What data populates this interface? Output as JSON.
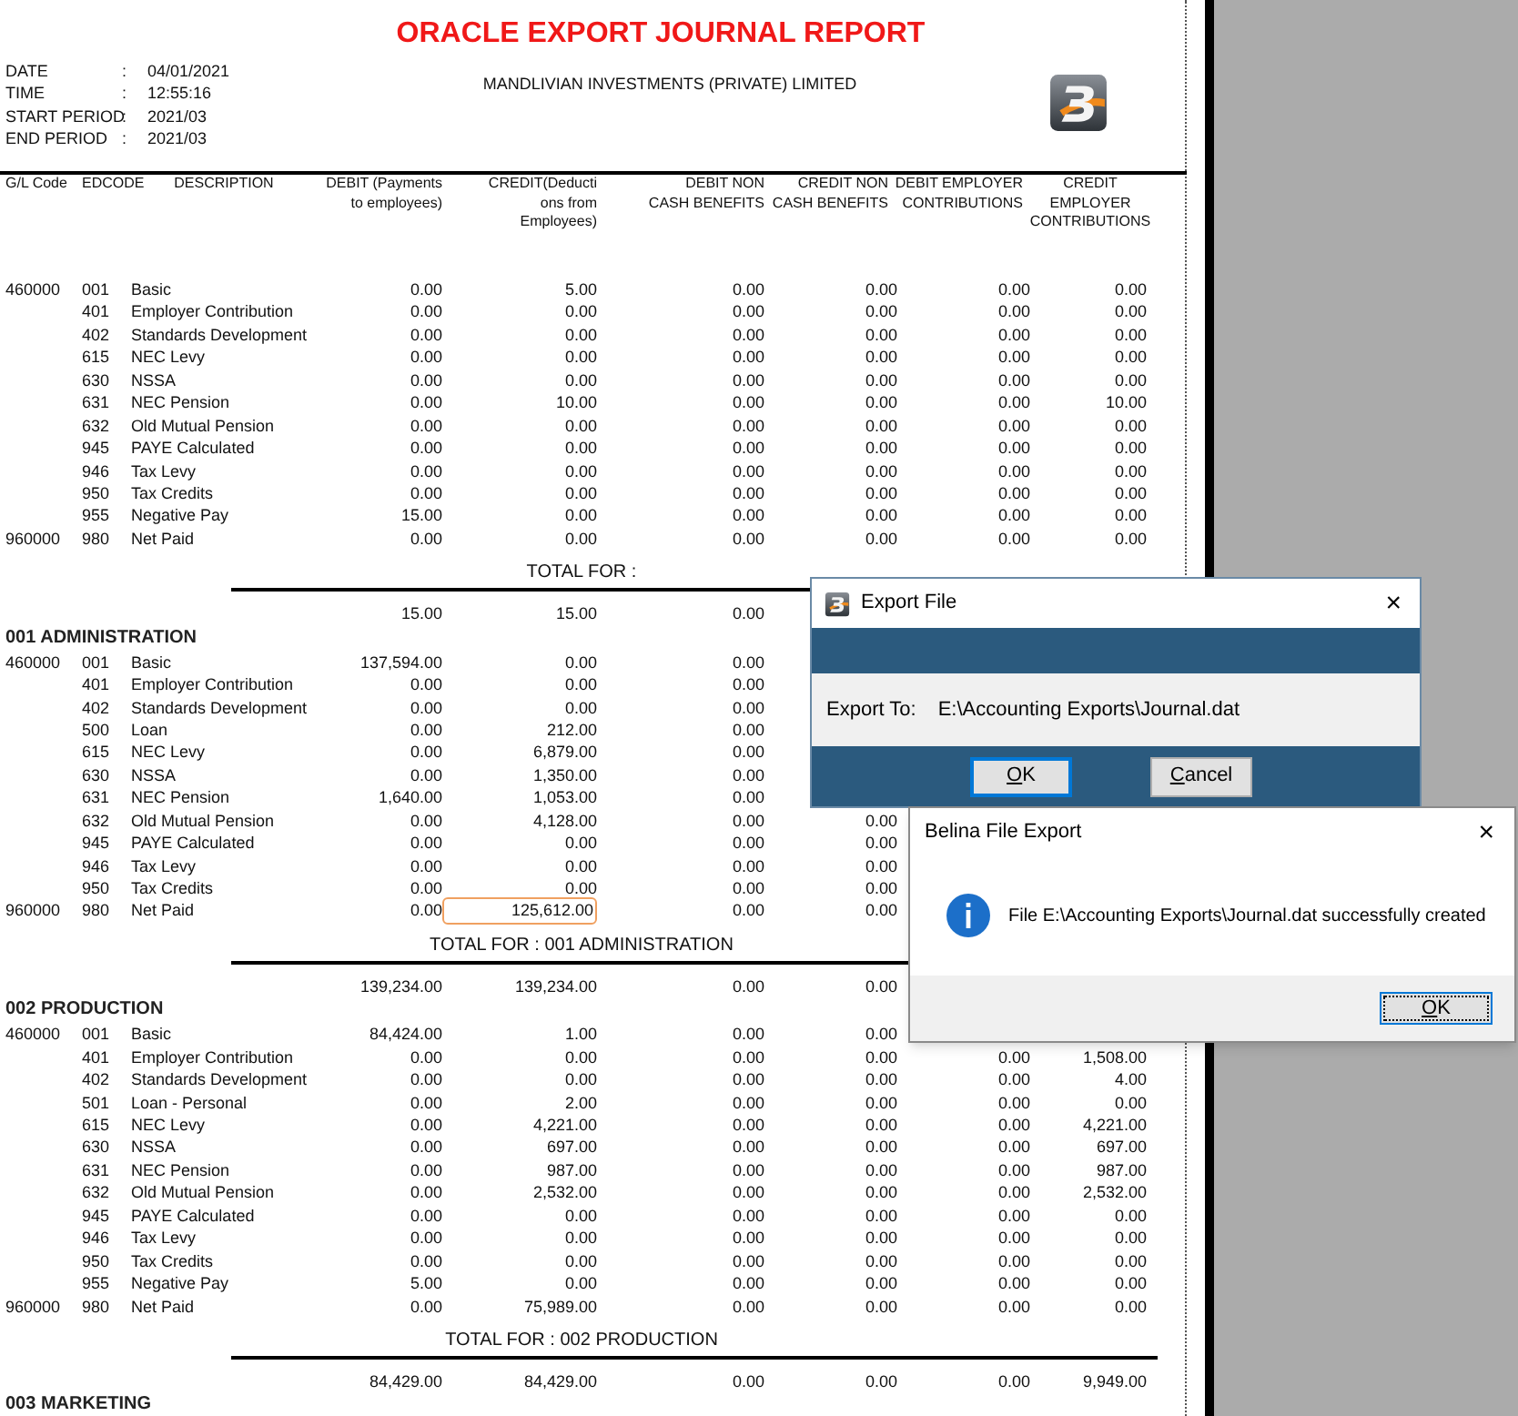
{
  "report": {
    "title": "ORACLE EXPORT JOURNAL REPORT",
    "company": "MANDLIVIAN INVESTMENTS (PRIVATE) LIMITED",
    "info": [
      {
        "label": "DATE",
        "colon": ":",
        "value": "04/01/2021"
      },
      {
        "label": "TIME",
        "colon": ":",
        "value": "12:55:16"
      },
      {
        "label": "START PERIOD",
        "colon": ":",
        "value": "2021/03"
      },
      {
        "label": "END PERIOD",
        "colon": ":",
        "value": "2021/03"
      }
    ],
    "columns": [
      {
        "lines": [
          "G/L Code"
        ]
      },
      {
        "lines": [
          "EDCODE"
        ]
      },
      {
        "lines": [
          "DESCRIPTION"
        ]
      },
      {
        "lines": [
          "DEBIT (Payments",
          "to employees)"
        ]
      },
      {
        "lines": [
          "CREDIT(Deducti",
          "ons from",
          "Employees)"
        ]
      },
      {
        "lines": [
          "DEBIT NON",
          "CASH BENEFITS"
        ]
      },
      {
        "lines": [
          "CREDIT NON",
          "CASH BENEFITS"
        ]
      },
      {
        "lines": [
          "DEBIT EMPLOYER",
          "CONTRIBUTIONS"
        ]
      },
      {
        "lines": [
          "CREDIT",
          "EMPLOYER",
          "CONTRIBUTIONS"
        ]
      }
    ],
    "sections": [
      {
        "rows": [
          {
            "gl_code": "460000",
            "ed_code": "001",
            "description": "Basic",
            "amounts": [
              "0.00",
              "5.00",
              "0.00",
              "0.00",
              "0.00",
              "0.00"
            ]
          },
          {
            "ed_code": "401",
            "description": "Employer Contribution",
            "amounts": [
              "0.00",
              "0.00",
              "0.00",
              "0.00",
              "0.00",
              "0.00"
            ]
          },
          {
            "ed_code": "402",
            "description": "Standards Development",
            "amounts": [
              "0.00",
              "0.00",
              "0.00",
              "0.00",
              "0.00",
              "0.00"
            ]
          },
          {
            "ed_code": "615",
            "description": "NEC Levy",
            "amounts": [
              "0.00",
              "0.00",
              "0.00",
              "0.00",
              "0.00",
              "0.00"
            ]
          },
          {
            "ed_code": "630",
            "description": "NSSA",
            "amounts": [
              "0.00",
              "0.00",
              "0.00",
              "0.00",
              "0.00",
              "0.00"
            ]
          },
          {
            "ed_code": "631",
            "description": "NEC Pension",
            "amounts": [
              "0.00",
              "10.00",
              "0.00",
              "0.00",
              "0.00",
              "10.00"
            ]
          },
          {
            "ed_code": "632",
            "description": "Old Mutual Pension",
            "amounts": [
              "0.00",
              "0.00",
              "0.00",
              "0.00",
              "0.00",
              "0.00"
            ]
          },
          {
            "ed_code": "945",
            "description": "PAYE Calculated",
            "amounts": [
              "0.00",
              "0.00",
              "0.00",
              "0.00",
              "0.00",
              "0.00"
            ]
          },
          {
            "ed_code": "946",
            "description": "Tax Levy",
            "amounts": [
              "0.00",
              "0.00",
              "0.00",
              "0.00",
              "0.00",
              "0.00"
            ]
          },
          {
            "ed_code": "950",
            "description": "Tax Credits",
            "amounts": [
              "0.00",
              "0.00",
              "0.00",
              "0.00",
              "0.00",
              "0.00"
            ]
          },
          {
            "ed_code": "955",
            "description": "Negative Pay",
            "amounts": [
              "15.00",
              "0.00",
              "0.00",
              "0.00",
              "0.00",
              "0.00"
            ]
          },
          {
            "gl_code": "960000",
            "ed_code": "980",
            "description": "Net Paid",
            "amounts": [
              "0.00",
              "0.00",
              "0.00",
              "0.00",
              "0.00",
              "0.00"
            ]
          }
        ],
        "total_label": "TOTAL FOR :",
        "totals": [
          "15.00",
          "15.00",
          "0.00"
        ]
      },
      {
        "title": "001 ADMINISTRATION",
        "rows": [
          {
            "gl_code": "460000",
            "ed_code": "001",
            "description": "Basic",
            "amounts": [
              "137,594.00",
              "0.00",
              "0.00"
            ]
          },
          {
            "ed_code": "401",
            "description": "Employer Contribution",
            "amounts": [
              "0.00",
              "0.00",
              "0.00"
            ]
          },
          {
            "ed_code": "402",
            "description": "Standards Development",
            "amounts": [
              "0.00",
              "0.00",
              "0.00"
            ]
          },
          {
            "ed_code": "500",
            "description": "Loan",
            "amounts": [
              "0.00",
              "212.00",
              "0.00"
            ]
          },
          {
            "ed_code": "615",
            "description": "NEC Levy",
            "amounts": [
              "0.00",
              "6,879.00",
              "0.00"
            ]
          },
          {
            "ed_code": "630",
            "description": "NSSA",
            "amounts": [
              "0.00",
              "1,350.00",
              "0.00"
            ]
          },
          {
            "ed_code": "631",
            "description": "NEC Pension",
            "amounts": [
              "1,640.00",
              "1,053.00",
              "0.00"
            ]
          },
          {
            "ed_code": "632",
            "description": "Old Mutual Pension",
            "amounts": [
              "0.00",
              "4,128.00",
              "0.00",
              "0.00"
            ]
          },
          {
            "ed_code": "945",
            "description": "PAYE Calculated",
            "amounts": [
              "0.00",
              "0.00",
              "0.00",
              "0.00"
            ]
          },
          {
            "ed_code": "946",
            "description": "Tax Levy",
            "amounts": [
              "0.00",
              "0.00",
              "0.00",
              "0.00"
            ]
          },
          {
            "ed_code": "950",
            "description": "Tax Credits",
            "amounts": [
              "0.00",
              "0.00",
              "0.00",
              "0.00"
            ]
          },
          {
            "gl_code": "960000",
            "ed_code": "980",
            "description": "Net Paid",
            "amounts": [
              "0.00",
              {
                "text": "125,612.00",
                "selected": true
              },
              "0.00",
              "0.00"
            ]
          }
        ],
        "total_label": "TOTAL FOR : 001 ADMINISTRATION",
        "totals": [
          "139,234.00",
          "139,234.00",
          "0.00",
          "0.00"
        ]
      },
      {
        "title": "002 PRODUCTION",
        "rows": [
          {
            "gl_code": "460000",
            "ed_code": "001",
            "description": "Basic",
            "amounts": [
              "84,424.00",
              "1.00",
              "0.00",
              "0.00"
            ]
          },
          {
            "ed_code": "401",
            "description": "Employer Contribution",
            "amounts": [
              "0.00",
              "0.00",
              "0.00",
              "0.00",
              "0.00",
              "1,508.00"
            ]
          },
          {
            "ed_code": "402",
            "description": "Standards Development",
            "amounts": [
              "0.00",
              "0.00",
              "0.00",
              "0.00",
              "0.00",
              "4.00"
            ]
          },
          {
            "ed_code": "501",
            "description": "Loan - Personal",
            "amounts": [
              "0.00",
              "2.00",
              "0.00",
              "0.00",
              "0.00",
              "0.00"
            ]
          },
          {
            "ed_code": "615",
            "description": "NEC Levy",
            "amounts": [
              "0.00",
              "4,221.00",
              "0.00",
              "0.00",
              "0.00",
              "4,221.00"
            ]
          },
          {
            "ed_code": "630",
            "description": "NSSA",
            "amounts": [
              "0.00",
              "697.00",
              "0.00",
              "0.00",
              "0.00",
              "697.00"
            ]
          },
          {
            "ed_code": "631",
            "description": "NEC Pension",
            "amounts": [
              "0.00",
              "987.00",
              "0.00",
              "0.00",
              "0.00",
              "987.00"
            ]
          },
          {
            "ed_code": "632",
            "description": "Old Mutual Pension",
            "amounts": [
              "0.00",
              "2,532.00",
              "0.00",
              "0.00",
              "0.00",
              "2,532.00"
            ]
          },
          {
            "ed_code": "945",
            "description": "PAYE Calculated",
            "amounts": [
              "0.00",
              "0.00",
              "0.00",
              "0.00",
              "0.00",
              "0.00"
            ]
          },
          {
            "ed_code": "946",
            "description": "Tax Levy",
            "amounts": [
              "0.00",
              "0.00",
              "0.00",
              "0.00",
              "0.00",
              "0.00"
            ]
          },
          {
            "ed_code": "950",
            "description": "Tax Credits",
            "amounts": [
              "0.00",
              "0.00",
              "0.00",
              "0.00",
              "0.00",
              "0.00"
            ]
          },
          {
            "ed_code": "955",
            "description": "Negative Pay",
            "amounts": [
              "5.00",
              "0.00",
              "0.00",
              "0.00",
              "0.00",
              "0.00"
            ]
          },
          {
            "gl_code": "960000",
            "ed_code": "980",
            "description": "Net Paid",
            "amounts": [
              "0.00",
              "75,989.00",
              "0.00",
              "0.00",
              "0.00",
              "0.00"
            ]
          }
        ],
        "total_label": "TOTAL FOR : 002 PRODUCTION",
        "totals": [
          "84,429.00",
          "84,429.00",
          "0.00",
          "0.00",
          "0.00",
          "9,949.00"
        ]
      },
      {
        "title": "003 MARKETING"
      }
    ]
  },
  "export_dialog": {
    "title": "Export File",
    "close": "×",
    "field_label": "Export To:",
    "path": "E:\\Accounting Exports\\Journal.dat",
    "buttons": [
      {
        "label": "OK",
        "default": true
      },
      {
        "label": "Cancel",
        "default": false
      }
    ]
  },
  "message_dialog": {
    "title": "Belina File Export",
    "close": "×",
    "message": "File E:\\Accounting Exports\\Journal.dat successfully created",
    "buttons": [
      {
        "label": "OK",
        "default": true
      }
    ]
  }
}
